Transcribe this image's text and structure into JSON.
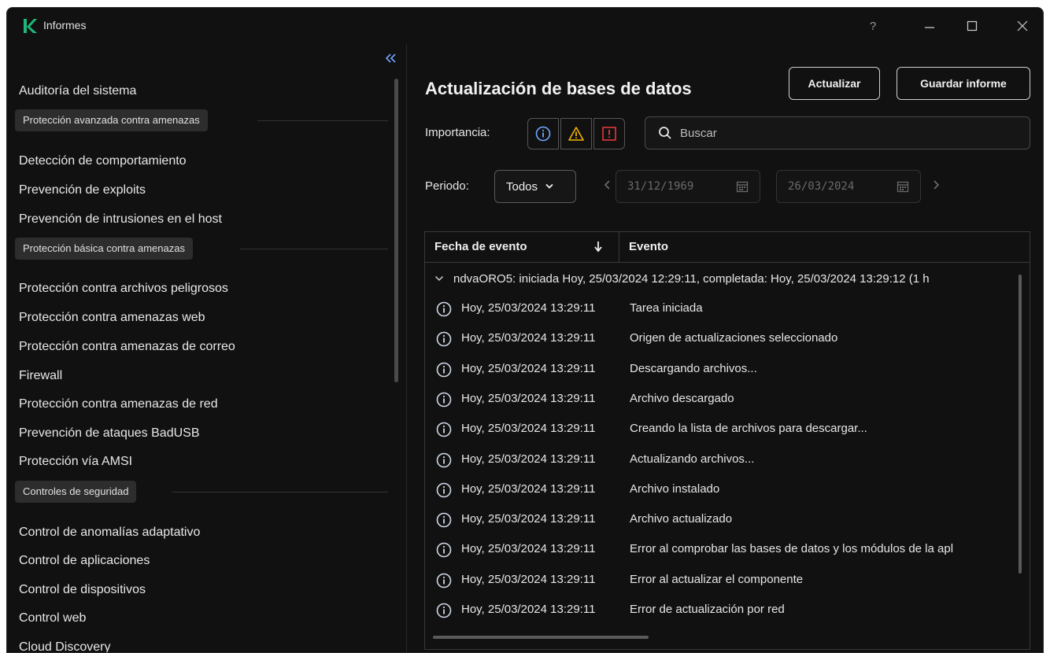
{
  "window": {
    "title": "Informes",
    "controls": {
      "help": "?"
    }
  },
  "sidebar": {
    "items": [
      {
        "type": "item",
        "label": "Auditoría del sistema"
      },
      {
        "type": "section",
        "label": "Protección avanzada contra amenazas"
      },
      {
        "type": "item",
        "label": "Detección de comportamiento"
      },
      {
        "type": "item",
        "label": "Prevención de exploits"
      },
      {
        "type": "item",
        "label": "Prevención de intrusiones en el host"
      },
      {
        "type": "section",
        "label": "Protección básica contra amenazas"
      },
      {
        "type": "item",
        "label": "Protección contra archivos peligrosos"
      },
      {
        "type": "item",
        "label": "Protección contra amenazas web"
      },
      {
        "type": "item",
        "label": "Protección contra amenazas de correo"
      },
      {
        "type": "item",
        "label": "Firewall"
      },
      {
        "type": "item",
        "label": "Protección contra amenazas de red"
      },
      {
        "type": "item",
        "label": "Prevención de ataques BadUSB"
      },
      {
        "type": "item",
        "label": "Protección vía AMSI"
      },
      {
        "type": "section",
        "label": "Controles de seguridad"
      },
      {
        "type": "item",
        "label": "Control de anomalías adaptativo"
      },
      {
        "type": "item",
        "label": "Control de aplicaciones"
      },
      {
        "type": "item",
        "label": "Control de dispositivos"
      },
      {
        "type": "item",
        "label": "Control web"
      },
      {
        "type": "item",
        "label": "Cloud Discovery"
      }
    ]
  },
  "main": {
    "title": "Actualización de bases de datos",
    "update_button": "Actualizar",
    "save_button": "Guardar informe",
    "importance_label": "Importancia:",
    "search_placeholder": "Buscar",
    "period_label": "Periodo:",
    "period_value": "Todos",
    "date_from": "31/12/1969",
    "date_to": "26/03/2024",
    "table": {
      "columns": [
        "Fecha de evento",
        "Evento"
      ],
      "group_label": "ndvaORO5: iniciada Hoy, 25/03/2024 12:29:11, completada: Hoy, 25/03/2024 13:29:12 (1 h",
      "rows": [
        {
          "date": "Hoy, 25/03/2024 13:29:11",
          "event": "Tarea iniciada"
        },
        {
          "date": "Hoy, 25/03/2024 13:29:11",
          "event": "Origen de actualizaciones seleccionado"
        },
        {
          "date": "Hoy, 25/03/2024 13:29:11",
          "event": "Descargando archivos..."
        },
        {
          "date": "Hoy, 25/03/2024 13:29:11",
          "event": "Archivo descargado"
        },
        {
          "date": "Hoy, 25/03/2024 13:29:11",
          "event": "Creando la lista de archivos para descargar..."
        },
        {
          "date": "Hoy, 25/03/2024 13:29:11",
          "event": "Actualizando archivos..."
        },
        {
          "date": "Hoy, 25/03/2024 13:29:11",
          "event": "Archivo instalado"
        },
        {
          "date": "Hoy, 25/03/2024 13:29:11",
          "event": "Archivo actualizado"
        },
        {
          "date": "Hoy, 25/03/2024 13:29:11",
          "event": "Error al comprobar las bases de datos y los módulos de la apl"
        },
        {
          "date": "Hoy, 25/03/2024 13:29:11",
          "event": "Error al actualizar el componente"
        },
        {
          "date": "Hoy, 25/03/2024 13:29:11",
          "event": "Error de actualización por red"
        }
      ]
    }
  },
  "colors": {
    "background": "#111111",
    "brand": "#1fb87a",
    "link": "#6fa8ff",
    "warning": "#f2b500",
    "critical": "#e5383b"
  }
}
